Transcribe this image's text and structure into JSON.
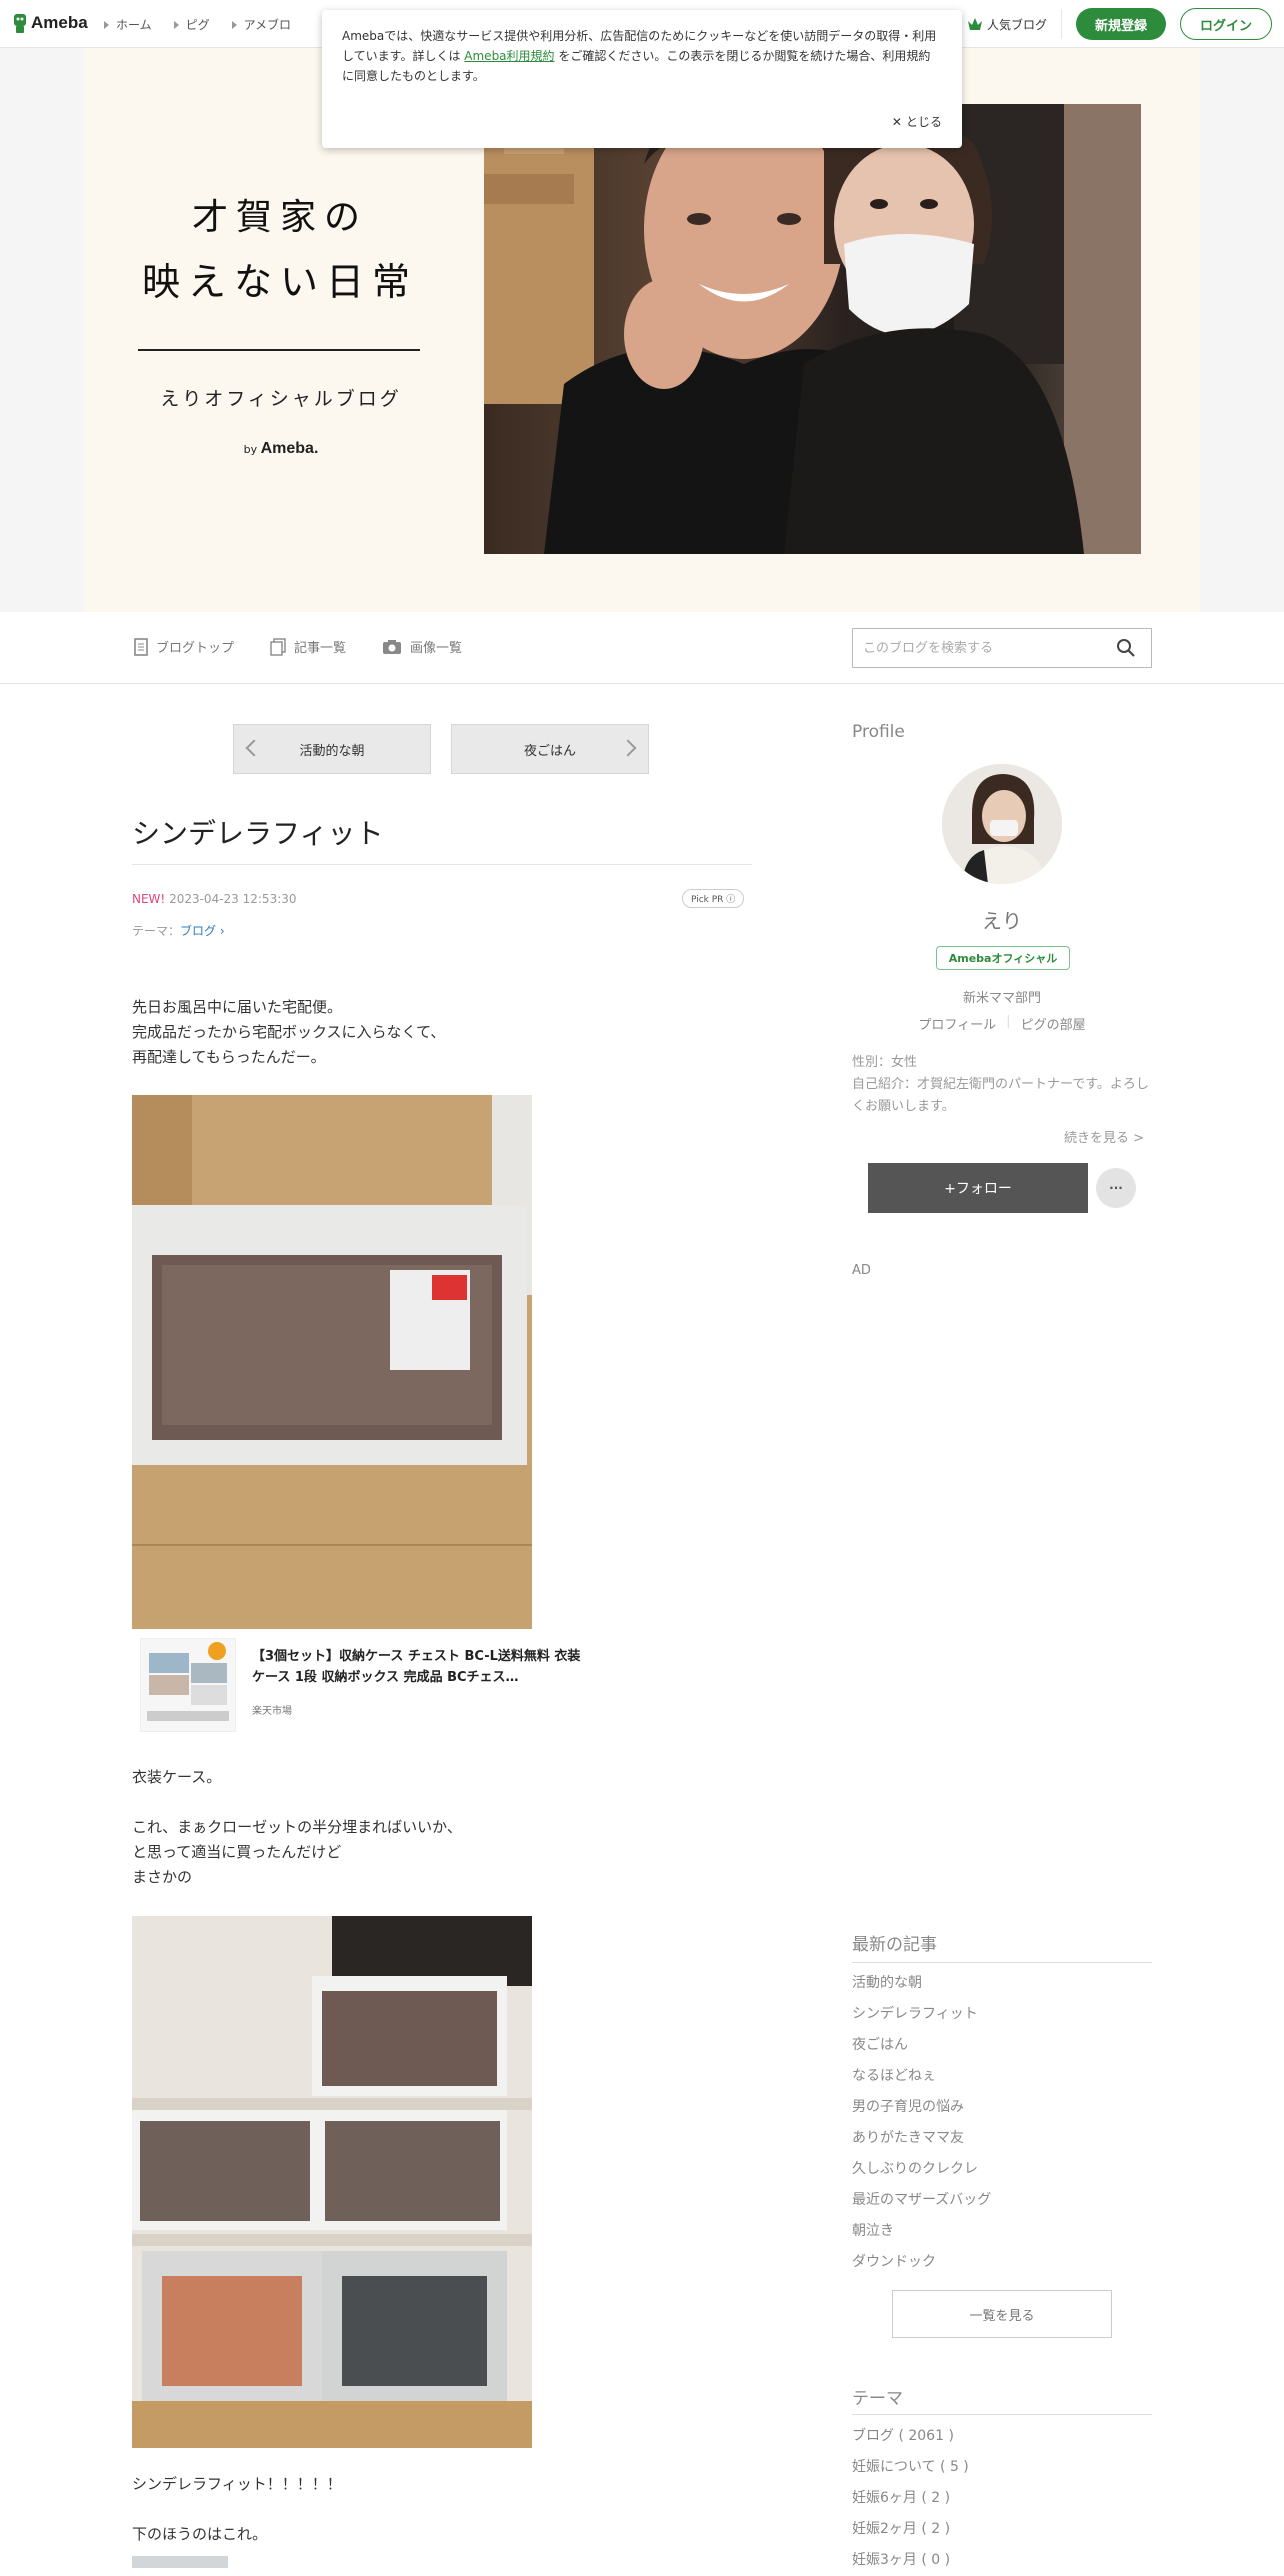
{
  "header": {
    "logo_text": "Ameba",
    "nav": [
      "ホーム",
      "ピグ",
      "アメブロ"
    ],
    "popular": "人気ブログ",
    "register": "新規登録",
    "login": "ログイン"
  },
  "cookie": {
    "text_before": "Amebaでは、快適なサービス提供や利用分析、広告配信のためにクッキーなどを使い訪問データの取得・利用しています。詳しくは",
    "link": "Ameba利用規約",
    "text_after": "をご確認ください。この表示を閉じるか閲覧を続けた場合、利用規約に同意したものとします。",
    "close": "とじる"
  },
  "banner": {
    "title_line1": "才賀家の",
    "title_line2": "映えない日常",
    "subtitle": "えりオフィシャルブログ",
    "by": "by",
    "by_brand": "Ameba."
  },
  "blognav": {
    "top": "ブログトップ",
    "list": "記事一覧",
    "images": "画像一覧",
    "search_placeholder": "このブログを検索する"
  },
  "article": {
    "prev": "活動的な朝",
    "next": "夜ごはん",
    "title": "シンデレラフィット",
    "new_label": "NEW!",
    "date": "2023-04-23 12:53:30",
    "pick": "Pick PR ⓘ",
    "theme_label": "テーマ：",
    "theme": "ブログ",
    "p1": "先日お風呂中に届いた宅配便。\n完成品だったから宅配ボックスに入らなくて、\n再配達してもらったんだー。",
    "product_title": "【3個セット】収納ケース チェスト BC-L送料無料 衣装ケース 1段 収納ボックス 完成品 BCチェス…",
    "product_shop": "楽天市場",
    "p2": "衣装ケース。",
    "p3": "これ、まぁクローゼットの半分埋まればいいか、\nと思って適当に買ったんだけど\nまさかの",
    "p4": "シンデレラフィット！！！！！",
    "p5": "下のほうのはこれ。"
  },
  "sidebar": {
    "profile_heading": "Profile",
    "name": "えり",
    "official_badge": "Amebaオフィシャル",
    "category": "新米ママ部門",
    "link_profile": "プロフィール",
    "link_room": "ピグの部屋",
    "gender": "性別：女性",
    "intro": "自己紹介：才賀紀左衛門のパートナーです。よろしくお願いします。",
    "more": "続きを見る >",
    "follow": "+フォロー",
    "more_btn": "···",
    "ad": "AD",
    "recent_heading": "最新の記事",
    "recent": [
      "活動的な朝",
      "シンデレラフィット",
      "夜ごはん",
      "なるほどねぇ",
      "男の子育児の悩み",
      "ありがたきママ友",
      "久しぶりのクレクレ",
      "最近のマザーズバッグ",
      "朝泣き",
      "ダウンドック"
    ],
    "list_all": "一覧を見る",
    "theme_heading": "テーマ",
    "themes": [
      "ブログ ( 2061 )",
      "妊娠について ( 5 )",
      "妊娠6ヶ月 ( 2 )",
      "妊娠2ヶ月 ( 2 )",
      "妊娠3ヶ月 ( 0 )"
    ]
  },
  "colors": {
    "brand_green": "#2d8c3c",
    "new_pink": "#e0457b",
    "link_blue": "#2e7bbd"
  }
}
